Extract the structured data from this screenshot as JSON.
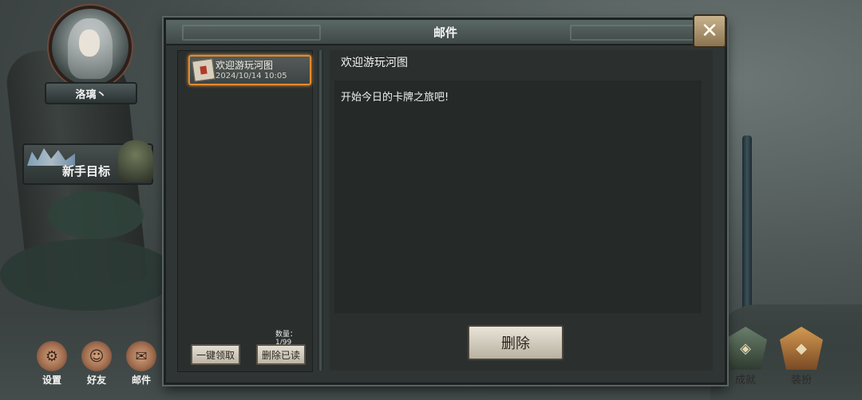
{
  "dialog": {
    "title": "邮件",
    "close_glyph": "✕"
  },
  "mail_list": {
    "items": [
      {
        "subject": "欢迎游玩河图",
        "date": "2024/10/14 10:05",
        "selected": true
      }
    ],
    "count_label": "数量：1/99",
    "claim_all_label": "一键领取",
    "delete_read_label": "删除已读"
  },
  "mail_detail": {
    "title": "欢迎游玩河图",
    "body": "开始今日的卡牌之旅吧!",
    "delete_label": "删除"
  },
  "player": {
    "name": "洛璃丶"
  },
  "goal": {
    "label": "新手目标"
  },
  "left_nav": [
    {
      "label": "设置",
      "icon": "gear-icon"
    },
    {
      "label": "好友",
      "icon": "friends-icon"
    },
    {
      "label": "邮件",
      "icon": "mail-icon"
    }
  ],
  "right_nav": [
    {
      "label": "成就",
      "icon": "achievement-icon"
    },
    {
      "label": "装扮",
      "icon": "costume-icon"
    }
  ],
  "colors": {
    "accent_orange": "#e48b2d",
    "panel": "#2f3534"
  }
}
